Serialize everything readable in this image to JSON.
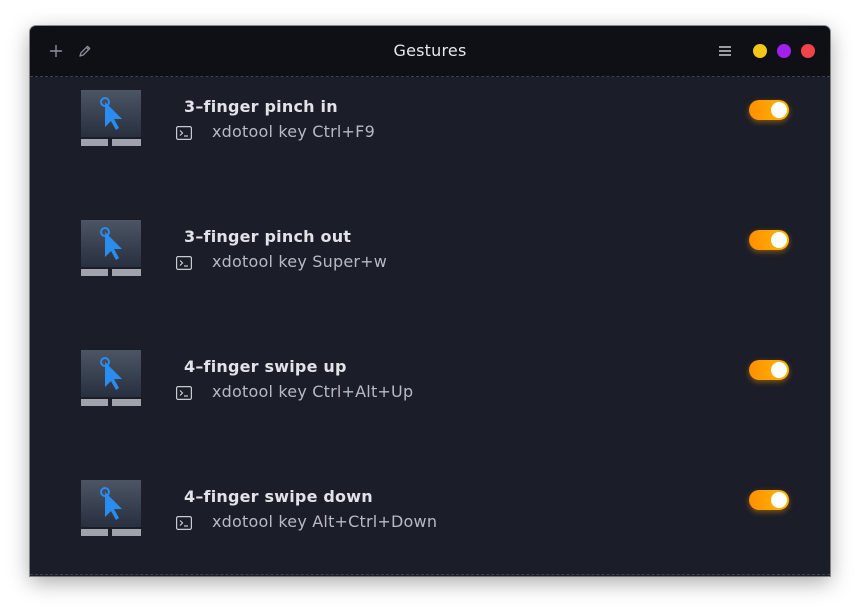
{
  "window": {
    "title": "Gestures",
    "toolbar": {
      "add_icon": "plus-icon",
      "edit_icon": "pencil-icon",
      "menu_icon": "hamburger-menu-icon"
    },
    "controls": [
      {
        "name": "minimize",
        "color": "#f5c518"
      },
      {
        "name": "maximize",
        "color": "#a31ff0"
      },
      {
        "name": "close",
        "color": "#f2434a"
      }
    ]
  },
  "colors": {
    "background": "#1b1d28",
    "titlebar": "#0f1016",
    "toggle_on": "#ffa000",
    "cursor": "#2b8cf0"
  },
  "gestures": [
    {
      "name": "3–finger pinch in",
      "command": "xdotool key Ctrl+F9",
      "enabled": true
    },
    {
      "name": "3–finger pinch out",
      "command": "xdotool key Super+w",
      "enabled": true
    },
    {
      "name": "4–finger swipe up",
      "command": "xdotool key Ctrl+Alt+Up",
      "enabled": true
    },
    {
      "name": "4–finger swipe down",
      "command": "xdotool key Alt+Ctrl+Down",
      "enabled": true
    }
  ]
}
